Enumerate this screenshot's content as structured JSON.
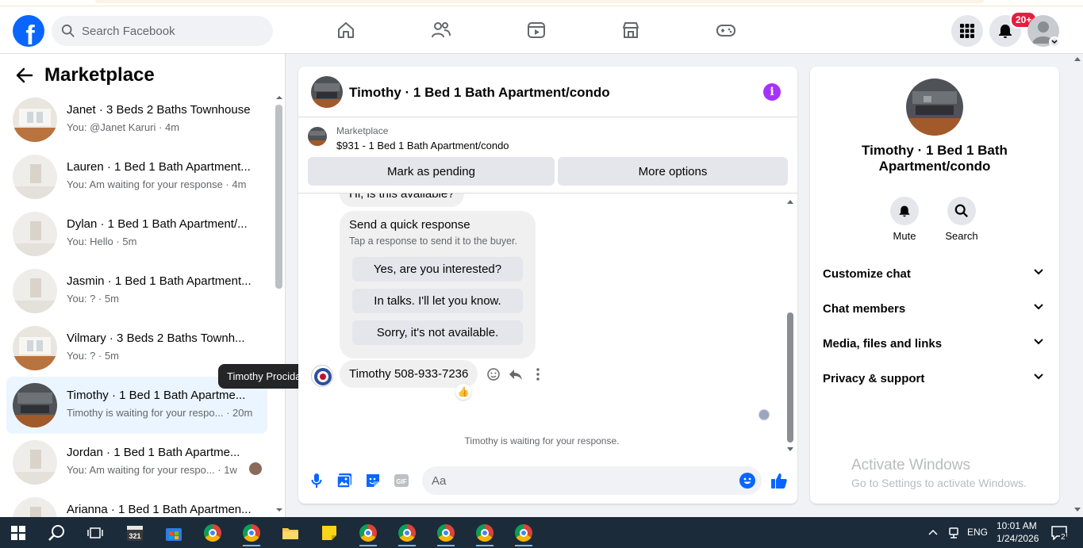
{
  "header": {
    "logo": "f",
    "search_placeholder": "Search Facebook",
    "notification_badge": "20+"
  },
  "sidebar": {
    "title": "Marketplace",
    "conversations": [
      {
        "name": "Janet · 3 Beds 2 Baths Townhouse",
        "preview": "You: @Janet Karuri · 4m",
        "thumb": "light"
      },
      {
        "name": "Lauren · 1 Bed 1 Bath Apartment...",
        "preview": "You: Am waiting for your response · 4m",
        "thumb": "pale"
      },
      {
        "name": "Dylan · 1 Bed 1 Bath Apartment/...",
        "preview": "You: Hello · 5m",
        "thumb": "pale"
      },
      {
        "name": "Jasmin · 1 Bed 1 Bath Apartment...",
        "preview": "You: ? · 5m",
        "thumb": "pale"
      },
      {
        "name": "Vilmary · 3 Beds 2 Baths Townh...",
        "preview": "You: ? · 5m",
        "thumb": "light"
      },
      {
        "name": "Timothy · 1 Bed 1 Bath Apartme...",
        "preview": "Timothy is waiting for your respo... · 20m",
        "thumb": "dark"
      },
      {
        "name": "Jordan · 1 Bed 1 Bath Apartme...",
        "preview": "You: Am waiting for your respo... · 1w",
        "thumb": "pale"
      },
      {
        "name": "Arianna · 1 Bed 1 Bath Apartmen...",
        "preview": "",
        "thumb": "pale"
      }
    ],
    "tooltip": "Timothy Procida"
  },
  "chat": {
    "title": "Timothy · 1 Bed 1 Bath Apartment/condo",
    "marketplace_label": "Marketplace",
    "listing": "$931 - 1 Bed 1 Bath Apartment/condo",
    "mark_pending": "Mark as pending",
    "more_options": "More options",
    "prev_message": "Hi, is this available?",
    "quick_title": "Send a quick response",
    "quick_sub": "Tap a response to send it to the buyer.",
    "quick_options": [
      "Yes, are you interested?",
      "In talks. I'll let you know.",
      "Sorry, it's not available."
    ],
    "phone_message": "Timothy 508-933-7236",
    "reaction": "👍",
    "waiting": "Timothy is waiting for your response.",
    "composer_placeholder": "Aa"
  },
  "details": {
    "title": "Timothy · 1 Bed 1 Bath Apartment/condo",
    "mute": "Mute",
    "search": "Search",
    "rows": [
      "Customize chat",
      "Chat members",
      "Media, files and links",
      "Privacy & support"
    ]
  },
  "watermark": {
    "line1": "Activate Windows",
    "line2": "Go to Settings to activate Windows."
  },
  "taskbar": {
    "lang": "ENG",
    "time": "10:01 AM",
    "date": "1/24/2026",
    "notif_count": "2"
  },
  "colors": {
    "brand": "#0866ff",
    "active_row": "#ebf5ff",
    "info": "#a533ff"
  }
}
